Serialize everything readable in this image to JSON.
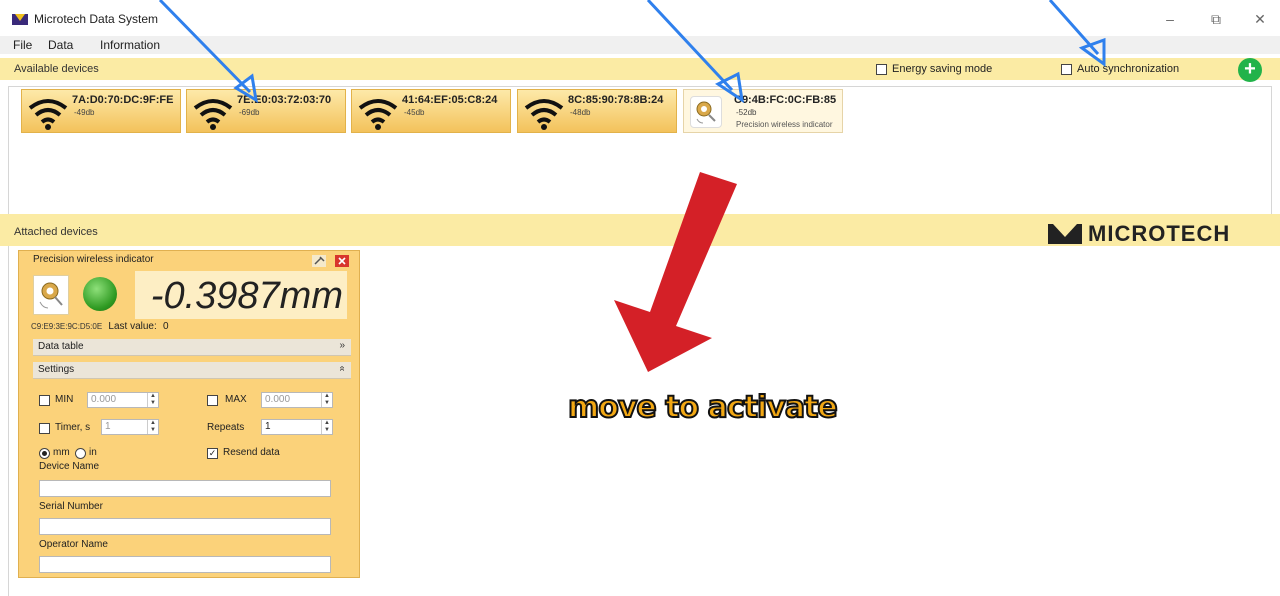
{
  "window": {
    "title": "Microtech Data System",
    "controls": {
      "minimize": "–",
      "restore": "⧉",
      "close": "✕"
    }
  },
  "menu": [
    "File",
    "Data",
    "Information"
  ],
  "available": {
    "label": "Available devices",
    "energy_saving_label": "Energy saving mode",
    "auto_sync_label": "Auto synchronization",
    "add_button": "+",
    "devices": [
      {
        "mac": "7A:D0:70:DC:9F:FE",
        "signal": "-49db"
      },
      {
        "mac": "7E:E0:03:72:03:70",
        "signal": "-69db"
      },
      {
        "mac": "41:64:EF:05:C8:24",
        "signal": "-45db"
      },
      {
        "mac": "8C:85:90:78:8B:24",
        "signal": "-48db"
      },
      {
        "mac": "C9:4B:FC:0C:FB:85",
        "signal": "-52db",
        "kind": "Precision wireless indicator"
      }
    ]
  },
  "attached": {
    "label": "Attached devices",
    "brand": "MICROTECH",
    "panel": {
      "title": "Precision wireless indicator",
      "value": "-0.3987mm",
      "mac": "C9:E9:3E:9C:D5:0E",
      "last_value_label": "Last value:",
      "last_value": "0",
      "data_table_label": "Data table",
      "settings_label": "Settings",
      "min_label": "MIN",
      "min_value": "0.000",
      "max_label": "MAX",
      "max_value": "0.000",
      "timer_label": "Timer, s",
      "timer_value": "1",
      "repeats_label": "Repeats",
      "repeats_value": "1",
      "unit_mm": "mm",
      "unit_in": "in",
      "resend_label": "Resend data",
      "resend_checked": true,
      "device_name_label": "Device Name",
      "serial_label": "Serial Number",
      "operator_label": "Operator Name"
    }
  },
  "annotation": {
    "text": "move to activate",
    "arrow_color": "#d42027",
    "pointer_color": "#2f80ed"
  }
}
